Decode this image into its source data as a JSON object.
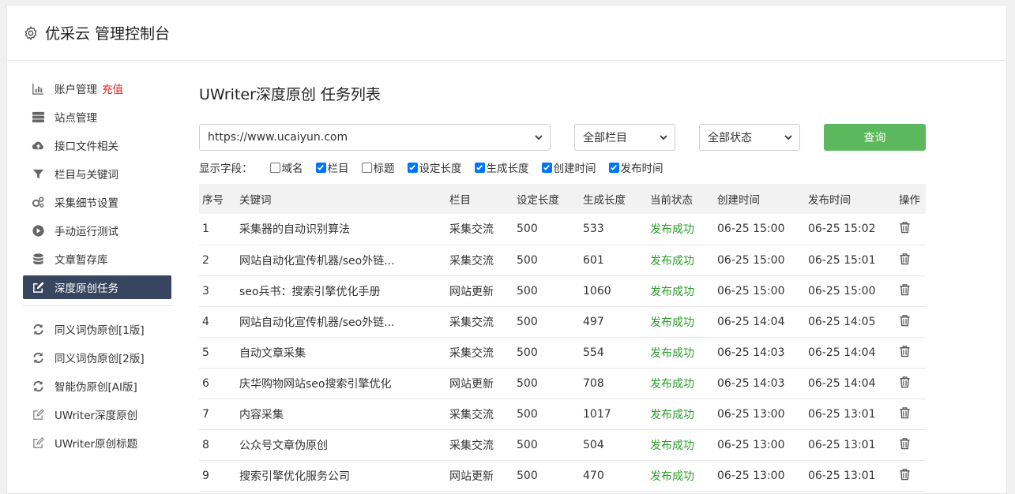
{
  "header": {
    "title": "优采云 管理控制台"
  },
  "sidebar": {
    "items": [
      {
        "label": "账户管理",
        "extra": "充值",
        "icon": "bar-chart-icon"
      },
      {
        "label": "站点管理",
        "icon": "server-icon"
      },
      {
        "label": "接口文件相关",
        "icon": "cloud-upload-icon"
      },
      {
        "label": "栏目与关键词",
        "icon": "filter-icon"
      },
      {
        "label": "采集细节设置",
        "icon": "gears-icon"
      },
      {
        "label": "手动运行测试",
        "icon": "play-circle-icon"
      },
      {
        "label": "文章暂存库",
        "icon": "database-icon"
      },
      {
        "label": "深度原创任务",
        "icon": "edit-icon",
        "active": true
      }
    ],
    "items2": [
      {
        "label": "同义词伪原创[1版]",
        "icon": "refresh-icon"
      },
      {
        "label": "同义词伪原创[2版]",
        "icon": "refresh-icon"
      },
      {
        "label": "智能伪原创[AI版]",
        "icon": "refresh-icon"
      },
      {
        "label": "UWriter深度原创",
        "icon": "edit-outline-icon"
      },
      {
        "label": "UWriter原创标题",
        "icon": "edit-outline-icon"
      }
    ]
  },
  "main": {
    "title": "UWriter深度原创 任务列表",
    "site_select": "https://www.ucaiyun.com",
    "column_select": "全部栏目",
    "status_select": "全部状态",
    "query_label": "查询",
    "fields_label": "显示字段：",
    "fields": [
      {
        "label": "域名",
        "checked": false
      },
      {
        "label": "栏目",
        "checked": true
      },
      {
        "label": "标题",
        "checked": false
      },
      {
        "label": "设定长度",
        "checked": true
      },
      {
        "label": "生成长度",
        "checked": true
      },
      {
        "label": "创建时间",
        "checked": true
      },
      {
        "label": "发布时间",
        "checked": true
      }
    ],
    "columns": [
      "序号",
      "关键词",
      "栏目",
      "设定长度",
      "生成长度",
      "当前状态",
      "创建时间",
      "发布时间",
      "操作"
    ],
    "rows": [
      [
        "1",
        "采集器的自动识别算法",
        "采集交流",
        "500",
        "533",
        "发布成功",
        "06-25 15:00",
        "06-25 15:02"
      ],
      [
        "2",
        "网站自动化宣传机器/seo外链...",
        "采集交流",
        "500",
        "601",
        "发布成功",
        "06-25 15:00",
        "06-25 15:01"
      ],
      [
        "3",
        "seo兵书：搜索引擎优化手册",
        "网站更新",
        "500",
        "1060",
        "发布成功",
        "06-25 15:00",
        "06-25 15:00"
      ],
      [
        "4",
        "网站自动化宣传机器/seo外链...",
        "采集交流",
        "500",
        "497",
        "发布成功",
        "06-25 14:04",
        "06-25 14:05"
      ],
      [
        "5",
        "自动文章采集",
        "采集交流",
        "500",
        "554",
        "发布成功",
        "06-25 14:03",
        "06-25 14:04"
      ],
      [
        "6",
        "庆华购物网站seo搜索引擎优化",
        "网站更新",
        "500",
        "708",
        "发布成功",
        "06-25 14:03",
        "06-25 14:04"
      ],
      [
        "7",
        "内容采集",
        "采集交流",
        "500",
        "1017",
        "发布成功",
        "06-25 13:00",
        "06-25 13:01"
      ],
      [
        "8",
        "公众号文章伪原创",
        "采集交流",
        "500",
        "504",
        "发布成功",
        "06-25 13:00",
        "06-25 13:01"
      ],
      [
        "9",
        "搜索引擎优化服务公司",
        "网站更新",
        "500",
        "470",
        "发布成功",
        "06-25 13:00",
        "06-25 13:01"
      ]
    ]
  }
}
